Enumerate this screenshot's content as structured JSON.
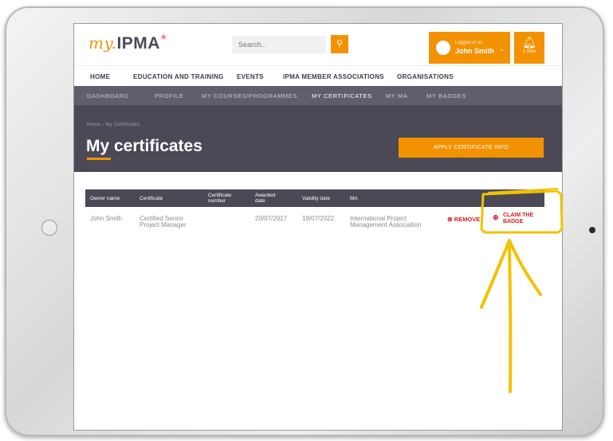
{
  "header": {
    "logo_my": "my.",
    "logo_ipma": "IPMA",
    "search_placeholder": "Search..",
    "user_small": "Logged in as",
    "user_name": "John Smith",
    "bell_label": "1 new"
  },
  "main_nav": [
    "HOME",
    "EDUCATION AND TRAINING",
    "EVENTS",
    "IPMA MEMBER ASSOCIATIONS",
    "ORGANISATIONS"
  ],
  "sub_nav": [
    "DASHBOARD",
    "PROFILE",
    "MY COURSES/PROGRAMMES",
    "MY CERTIFICATES",
    "MY MA",
    "MY BADGES"
  ],
  "hero": {
    "breadcrumb": "Home  ›  My Certificates",
    "title": "My certificates",
    "apply_button": "APPLY CERTIFICATE INFO"
  },
  "table": {
    "headers": [
      "Owner name",
      "Certificate",
      "Certificate number",
      "Awarded date",
      "Validity date",
      "MA"
    ],
    "row": {
      "owner": "John Smith",
      "certificate": "Certified Senior Project Manager",
      "number": "",
      "awarded": "20/07/2017",
      "validity": "19/07/2022",
      "ma": "International Project Management Association",
      "remove_label": "REMOVE",
      "claim_label": "CLAIM THE BADGE"
    }
  },
  "colors": {
    "accent": "#f39200",
    "dark_band": "#4a4955",
    "subnav": "#5f5e6b",
    "danger": "#d71920",
    "highlight": "#f2c200"
  }
}
